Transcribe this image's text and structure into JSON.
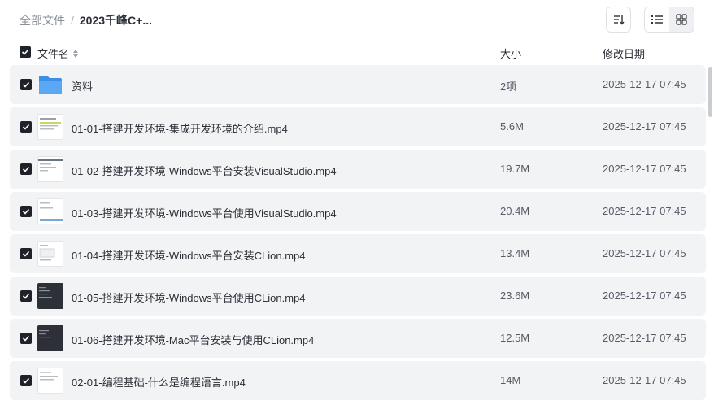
{
  "breadcrumb": {
    "root": "全部文件",
    "separator": "/",
    "current": "2023千峰C+..."
  },
  "toolbar": {
    "sort_icon": "sort-icon",
    "list_view_icon": "list-view-icon",
    "grid_view_icon": "grid-view-icon"
  },
  "table": {
    "headers": {
      "name": "文件名",
      "size": "大小",
      "date": "修改日期"
    },
    "rows": [
      {
        "name": "资料",
        "size": "2项",
        "date": "2025-12-17 07:45",
        "type": "folder"
      },
      {
        "name": "01-01-搭建开发环境-集成开发环境的介绍.mp4",
        "size": "5.6M",
        "date": "2025-12-17 07:45",
        "type": "video-light"
      },
      {
        "name": "01-02-搭建开发环境-Windows平台安装VisualStudio.mp4",
        "size": "19.7M",
        "date": "2025-12-17 07:45",
        "type": "video-light"
      },
      {
        "name": "01-03-搭建开发环境-Windows平台使用VisualStudio.mp4",
        "size": "20.4M",
        "date": "2025-12-17 07:45",
        "type": "video-light"
      },
      {
        "name": "01-04-搭建开发环境-Windows平台安装CLion.mp4",
        "size": "13.4M",
        "date": "2025-12-17 07:45",
        "type": "video-light"
      },
      {
        "name": "01-05-搭建开发环境-Windows平台使用CLion.mp4",
        "size": "23.6M",
        "date": "2025-12-17 07:45",
        "type": "video-dark"
      },
      {
        "name": "01-06-搭建开发环境-Mac平台安装与使用CLion.mp4",
        "size": "12.5M",
        "date": "2025-12-17 07:45",
        "type": "video-dark"
      },
      {
        "name": "02-01-编程基础-什么是编程语言.mp4",
        "size": "14M",
        "date": "2025-12-17 07:45",
        "type": "video-light"
      }
    ]
  },
  "colors": {
    "row_bg": "#f2f3f5",
    "folder": "#4a9bf0",
    "checkbox": "#1f2329"
  }
}
